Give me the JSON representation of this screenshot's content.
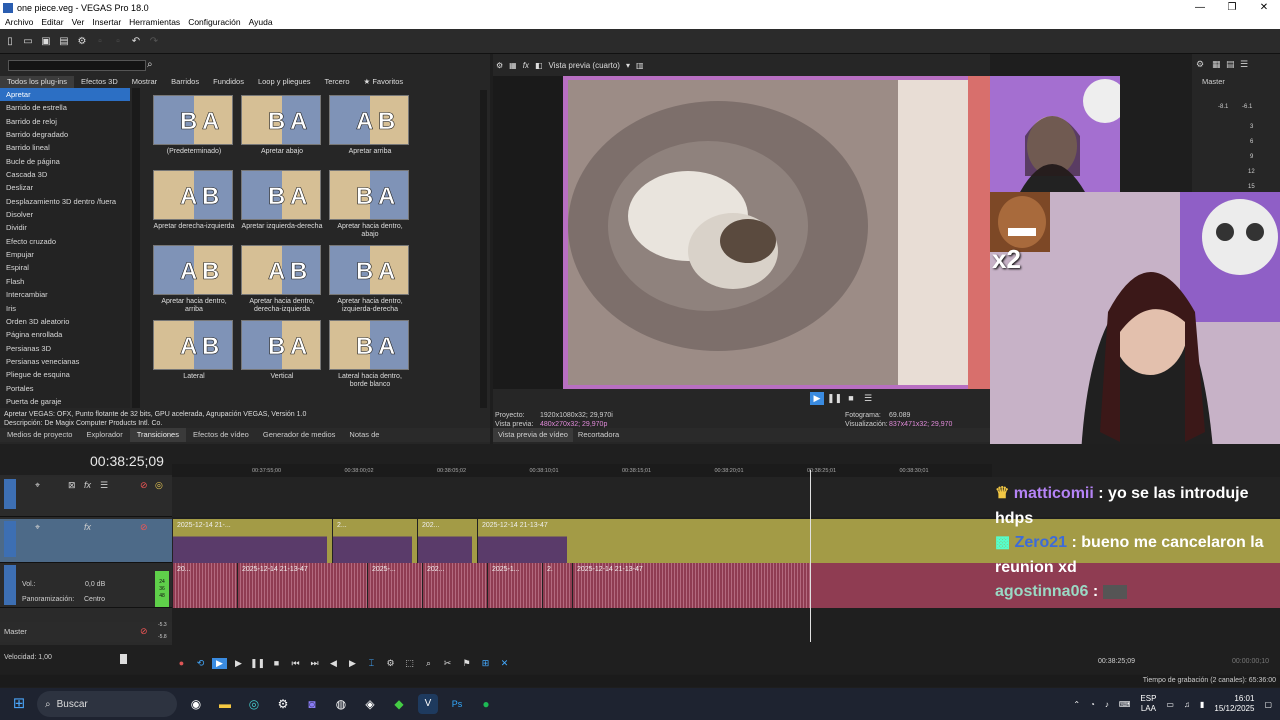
{
  "window": {
    "title": "one piece.veg - VEGAS Pro 18.0"
  },
  "menu": [
    "Archivo",
    "Editar",
    "Ver",
    "Insertar",
    "Herramientas",
    "Configuración",
    "Ayuda"
  ],
  "plugins": {
    "tabs": [
      "Todos los plug-ins",
      "Efectos 3D",
      "Mostrar",
      "Barridos",
      "Fundidos",
      "Loop y pliegues",
      "Tercero",
      "★ Favoritos"
    ],
    "list": [
      "Apretar",
      "Barrido de estrella",
      "Barrido de reloj",
      "Barrido degradado",
      "Barrido lineal",
      "Bucle de página",
      "Cascada 3D",
      "Deslizar",
      "Desplazamiento 3D dentro /fuera",
      "Disolver",
      "Dividir",
      "Efecto cruzado",
      "Empujar",
      "Espiral",
      "Flash",
      "Intercambiar",
      "Iris",
      "Orden 3D aleatorio",
      "Página enrollada",
      "Persianas 3D",
      "Persianas venecianas",
      "Pliegue de esquina",
      "Portales",
      "Puerta de garaje"
    ],
    "presets": [
      "(Predeterminado)",
      "Apretar abajo",
      "Apretar arriba",
      "Apretar derecha-izquierda",
      "Apretar izquierda-derecha",
      "Apretar hacia dentro, abajo",
      "Apretar hacia dentro, arriba",
      "Apretar hacia dentro, derecha-izquierda",
      "Apretar hacia dentro, izquierda-derecha",
      "Lateral",
      "Vertical",
      "Lateral hacia dentro, borde blanco"
    ],
    "info_line1": "Apretar VEGAS: OFX, Punto flotante de 32 bits, GPU acelerada, Agrupación VEGAS, Versión 1.0",
    "info_line2": "Descripción: De Magix Computer Products Intl. Co."
  },
  "left_bottom_tabs": [
    "Medios de proyecto",
    "Explorador",
    "Transiciones",
    "Efectos de vídeo",
    "Generador de medios",
    "Notas de"
  ],
  "preview": {
    "mode_label": "Vista previa (cuarto)",
    "proyecto_label": "Proyecto:",
    "proyecto_value": "1920x1080x32; 29,970i",
    "vista_label": "Vista previa:",
    "vista_value": "480x270x32; 29,970p",
    "fotograma_label": "Fotograma:",
    "fotograma_value": "69.089",
    "visualizacion_label": "Visualización:",
    "visualizacion_value": "837x471x32; 29,970",
    "tabs": [
      "Vista previa de vídeo",
      "Recortadora"
    ]
  },
  "mixer": {
    "title": "Master",
    "peak_left": "-8.1",
    "peak_right": "-6.1",
    "scale": [
      "3",
      "6",
      "9",
      "12",
      "15"
    ]
  },
  "timeline": {
    "timecode": "00:38:25;09",
    "ruler_ticks": [
      "00:37:55;00",
      "00:38:00;02",
      "00:38:05;02",
      "00:38:10;01",
      "00:38:15;01",
      "00:38:20;01",
      "00:38:25;01",
      "00:38:30;01"
    ],
    "video_clips": [
      "2025-12-14 21-...",
      "2...",
      "202...",
      "2025-12-14 21-13-47"
    ],
    "audio_clips": [
      "20...",
      "2025-12-14 21-13-47",
      "2025-...",
      "202...",
      "2025-1...",
      "2.",
      "2025-12-14 21-13-47"
    ],
    "vol_label": "Vol.:",
    "vol_value": "0,0 dB",
    "pan_label": "Panoramización:",
    "pan_value": "Centro",
    "meter_values": [
      "24",
      "36",
      "48"
    ],
    "master_label": "Master",
    "master_peak1": "-5.3",
    "master_peak2": "-5.8",
    "speed_label": "Velocidad: 1,00",
    "cursor_time": "00:38:25;09",
    "end_time": "00:00:00;10",
    "rec_time": "Tiempo de grabación (2 canales): 65:36:00"
  },
  "chat": [
    {
      "user": "matticomii",
      "text": ": yo se las introduje hdps"
    },
    {
      "user": "Zero21",
      "text": ": bueno me cancelaron la reunion xd"
    },
    {
      "user": "agostinna06",
      "text": ":"
    }
  ],
  "overlay": {
    "multiplier": "x2"
  },
  "taskbar": {
    "search_placeholder": "Buscar",
    "lang_line1": "ESP",
    "lang_line2": "LAA",
    "time": "16:01",
    "date": "15/12/2025"
  },
  "colors": {
    "selection": "#2c6fc4",
    "video_track": "#a39b46",
    "audio_track": "#8f3c52",
    "chat_user1": "#b483f5",
    "chat_user2": "#3d6bd8",
    "chat_user3": "#9ad9c4"
  }
}
